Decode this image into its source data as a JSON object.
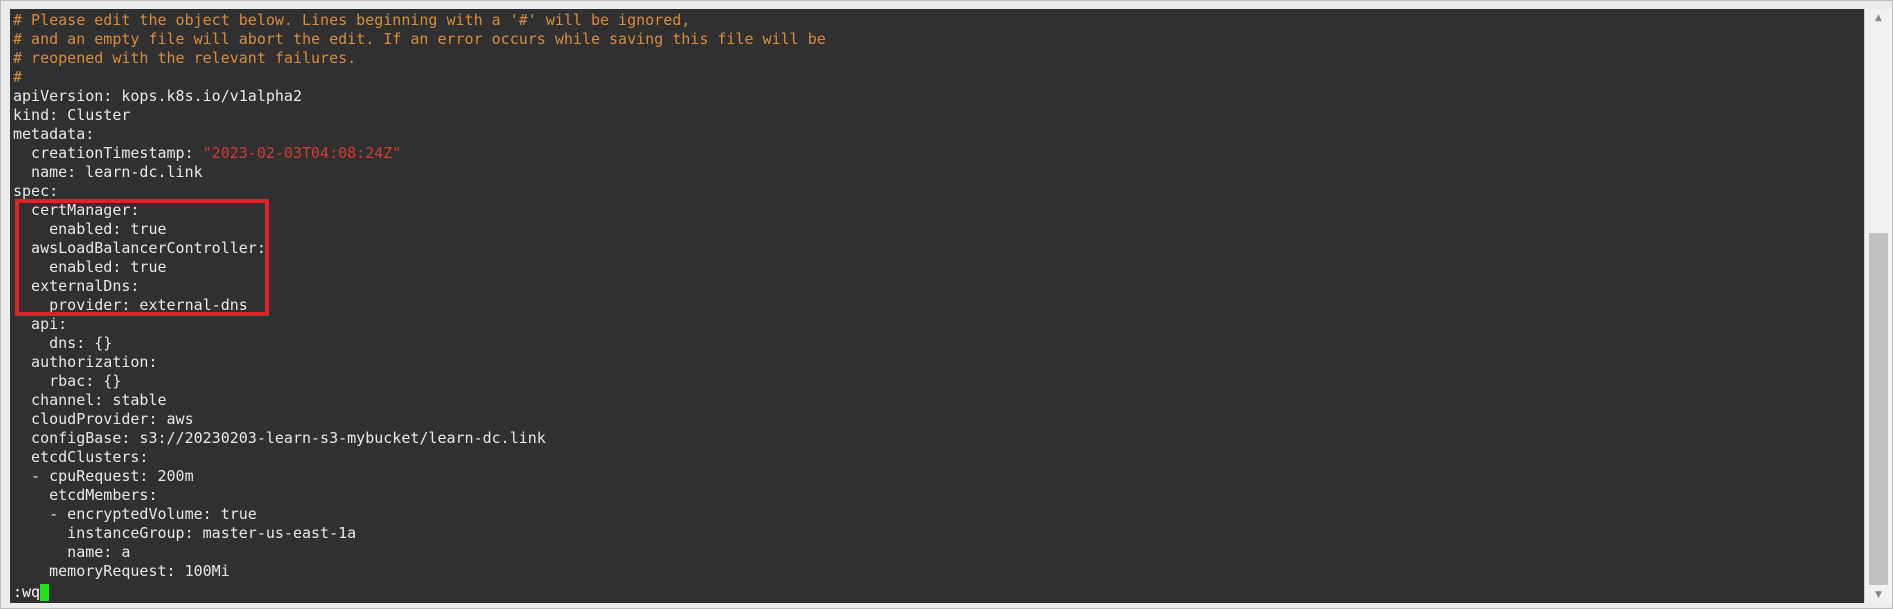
{
  "editor": {
    "lines": [
      {
        "key": "",
        "text": "# Please edit the object below. Lines beginning with a '#' will be ignored,",
        "comment": true
      },
      {
        "key": "",
        "text": "# and an empty file will abort the edit. If an error occurs while saving this file will be",
        "comment": true
      },
      {
        "key": "",
        "text": "# reopened with the relevant failures.",
        "comment": true
      },
      {
        "key": "",
        "text": "#",
        "comment": true
      },
      {
        "key": "apiVersion",
        "text": "apiVersion: kops.k8s.io/v1alpha2"
      },
      {
        "key": "kind",
        "text": "kind: Cluster"
      },
      {
        "key": "metadata",
        "text": "metadata:"
      },
      {
        "key": "creationTimestamp",
        "text": "  creationTimestamp: ",
        "str": "\"2023-02-03T04:08:24Z\""
      },
      {
        "key": "name",
        "text": "  name: learn-dc.link"
      },
      {
        "key": "spec",
        "text": "spec:"
      },
      {
        "key": "certManager",
        "text": "  certManager:"
      },
      {
        "key": "enabled",
        "text": "    enabled: true"
      },
      {
        "key": "awsLoadBalancerController",
        "text": "  awsLoadBalancerController:"
      },
      {
        "key": "enabled",
        "text": "    enabled: true"
      },
      {
        "key": "externalDns",
        "text": "  externalDns:"
      },
      {
        "key": "provider",
        "text": "    provider: external-dns"
      },
      {
        "key": "api",
        "text": "  api:"
      },
      {
        "key": "dns",
        "text": "    dns: {}"
      },
      {
        "key": "authorization",
        "text": "  authorization:"
      },
      {
        "key": "rbac",
        "text": "    rbac: {}"
      },
      {
        "key": "channel",
        "text": "  channel: stable"
      },
      {
        "key": "cloudProvider",
        "text": "  cloudProvider: aws"
      },
      {
        "key": "configBase",
        "text": "  configBase: s3://20230203-learn-s3-mybucket/learn-dc.link"
      },
      {
        "key": "etcdClusters",
        "text": "  etcdClusters:"
      },
      {
        "key": "cpuRequest",
        "text": "  - cpuRequest: 200m"
      },
      {
        "key": "etcdMembers",
        "text": "    etcdMembers:"
      },
      {
        "key": "encryptedVolume",
        "text": "    - encryptedVolume: true"
      },
      {
        "key": "instanceGroup",
        "text": "      instanceGroup: master-us-east-1a"
      },
      {
        "key": "name",
        "text": "      name: a"
      },
      {
        "key": "memoryRequest",
        "text": "    memoryRequest: 100Mi"
      }
    ],
    "command_line": ":wq",
    "colors": {
      "background": "#303030",
      "text": "#e8e8e8",
      "comment": "#d88c3e",
      "string": "#d23b32",
      "cursor": "#20e020",
      "highlight": "#e0202a"
    }
  },
  "scrollbar": {
    "up_icon": "scroll-up-arrow-icon",
    "down_icon": "scroll-down-arrow-icon"
  }
}
